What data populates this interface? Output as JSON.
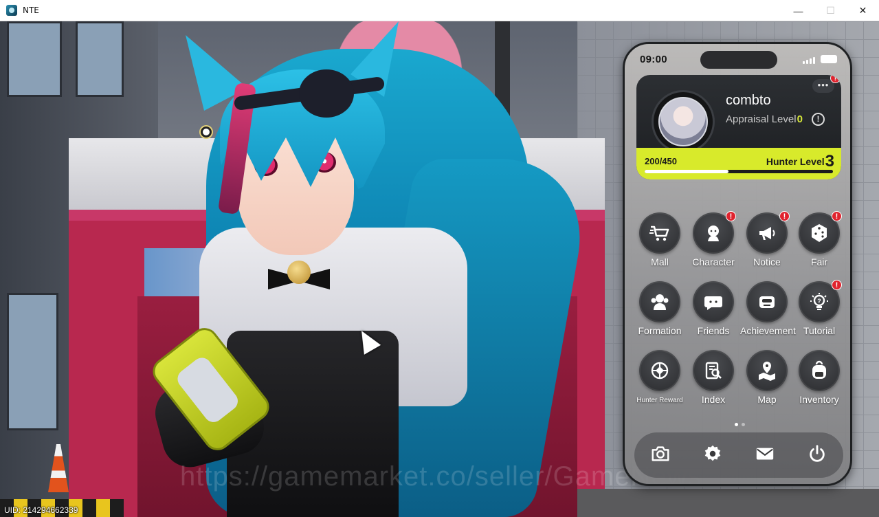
{
  "window": {
    "title": "NTE"
  },
  "overlay": {
    "uid": "UID: 214294662339",
    "watermark": "https://gamemarket.co/seller/GameNews"
  },
  "phone": {
    "clock": "09:00",
    "profile": {
      "username": "combto",
      "appraisal_label": "Appraisal Level",
      "appraisal_level": "0",
      "exp_text": "200/450",
      "exp_current": 200,
      "exp_max": 450,
      "hunter_label": "Hunter Level",
      "hunter_level": "3",
      "more_badge": "!"
    },
    "apps": [
      {
        "label": "Mall",
        "icon": "cart-icon",
        "badge": ""
      },
      {
        "label": "Character",
        "icon": "character-icon",
        "badge": "!"
      },
      {
        "label": "Notice",
        "icon": "megaphone-icon",
        "badge": "!"
      },
      {
        "label": "Fair",
        "icon": "dice-icon",
        "badge": "!"
      },
      {
        "label": "Formation",
        "icon": "formation-icon",
        "badge": ""
      },
      {
        "label": "Friends",
        "icon": "friends-icon",
        "badge": ""
      },
      {
        "label": "Achievement",
        "icon": "achievement-icon",
        "badge": ""
      },
      {
        "label": "Tutorial",
        "icon": "lightbulb-icon",
        "badge": "!"
      },
      {
        "label": "Hunter Reward",
        "icon": "crosshair-icon",
        "badge": ""
      },
      {
        "label": "Index",
        "icon": "index-icon",
        "badge": ""
      },
      {
        "label": "Map",
        "icon": "map-icon",
        "badge": ""
      },
      {
        "label": "Inventory",
        "icon": "backpack-icon",
        "badge": ""
      }
    ],
    "pages": {
      "current": 1,
      "total": 2
    },
    "dock": [
      {
        "icon": "camera-icon"
      },
      {
        "icon": "settings-icon"
      },
      {
        "icon": "mail-icon"
      },
      {
        "icon": "power-icon"
      }
    ],
    "colors": {
      "accent": "#d8ea2b",
      "badge": "#e0232e"
    }
  }
}
